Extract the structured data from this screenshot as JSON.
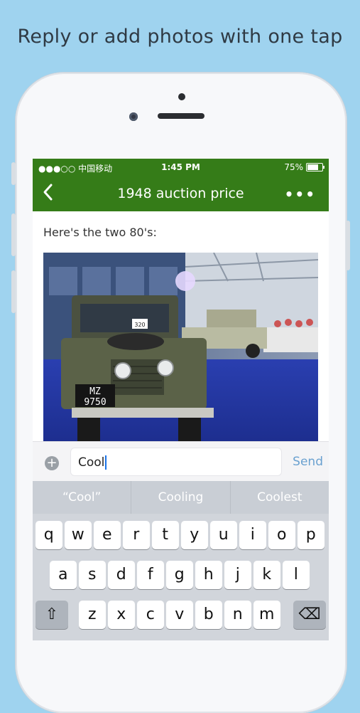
{
  "headline": "Reply or add photos with one tap",
  "status": {
    "carrier": "●●●○○ 中国移动",
    "time": "1:45 PM",
    "battery": "75%",
    "battery_level": 0.75
  },
  "nav": {
    "back_icon": "chevron-left",
    "title": "1948 auction price",
    "more_icon": "•••"
  },
  "message": {
    "text": "Here's the two 80's:",
    "photo_alt": "Two vintage Land Rovers at auction hall",
    "plate": "MZ 9750",
    "lot": "320"
  },
  "composer": {
    "input_value": "Cool",
    "send_label": "Send",
    "add_icon": "+"
  },
  "suggestions": [
    "“Cool”",
    "Cooling",
    "Coolest"
  ],
  "keys": {
    "row1": [
      "q",
      "w",
      "e",
      "r",
      "t",
      "y",
      "u",
      "i",
      "o",
      "p"
    ],
    "row2": [
      "a",
      "s",
      "d",
      "f",
      "g",
      "h",
      "j",
      "k",
      "l"
    ],
    "row3": [
      "z",
      "x",
      "c",
      "v",
      "b",
      "n",
      "m"
    ],
    "shift": "⇧",
    "backspace": "⌫"
  },
  "colors": {
    "bar": "#357c18",
    "background": "#9fd3ef",
    "send": "#6aa1d0"
  }
}
